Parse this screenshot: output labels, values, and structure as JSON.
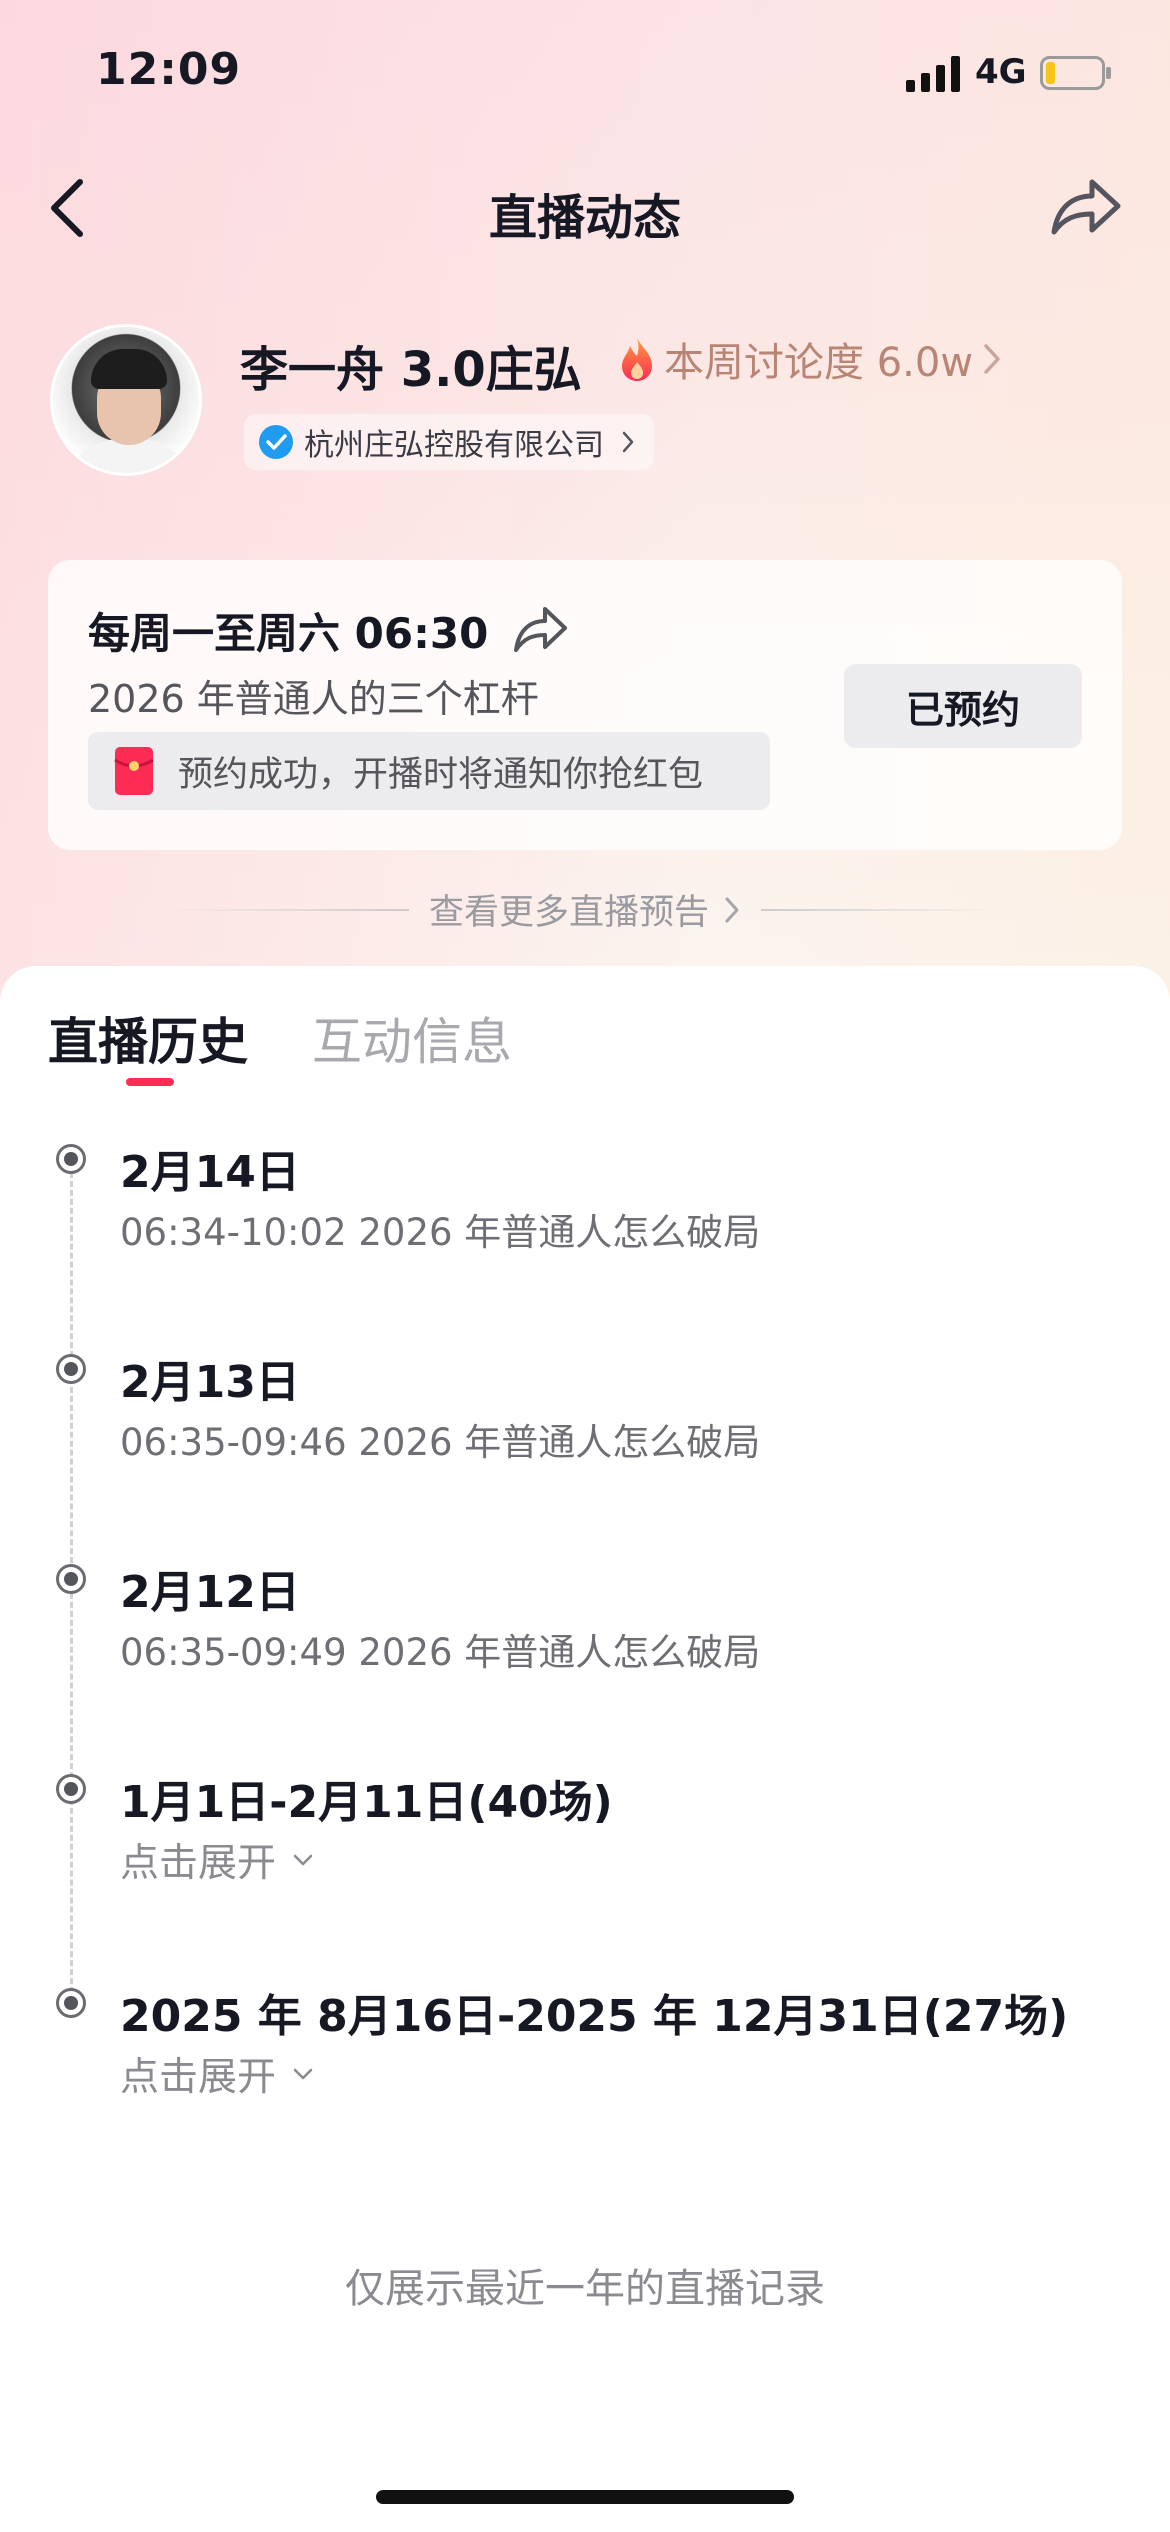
{
  "status_bar": {
    "time": "12:09",
    "network": "4G",
    "battery_color": "#f5c518"
  },
  "nav": {
    "title": "直播动态",
    "back_icon": "chevron-left-icon",
    "share_icon": "share-arrow-icon"
  },
  "profile": {
    "name": "李一舟 3.0庄弘",
    "heat_label": "本周讨论度 6.0w",
    "company": "杭州庄弘控股有限公司"
  },
  "reservation": {
    "schedule": "每周一至周六 06:30",
    "topic": "2026 年普通人的三个杠杆",
    "notice": "预约成功，开播时将通知你抢红包",
    "button_label": "已预约"
  },
  "more_preview": "查看更多直播预告",
  "tabs": [
    {
      "label": "直播历史",
      "active": true
    },
    {
      "label": "互动信息",
      "active": false
    }
  ],
  "timeline": [
    {
      "title": "2月14日",
      "detail": "06:34-10:02 2026 年普通人怎么破局"
    },
    {
      "title": "2月13日",
      "detail": "06:35-09:46 2026 年普通人怎么破局"
    },
    {
      "title": "2月12日",
      "detail": "06:35-09:49 2026 年普通人怎么破局"
    },
    {
      "title": "1月1日-2月11日(40场)",
      "expand_label": "点击展开"
    },
    {
      "title": "2025 年 8月16日-2025 年 12月31日(27场)",
      "expand_label": "点击展开"
    }
  ],
  "footer_note": "仅展示最近一年的直播记录",
  "colors": {
    "accent": "#fe2c55",
    "heat_text": "#b88474",
    "verified": "#1f9bf0"
  }
}
